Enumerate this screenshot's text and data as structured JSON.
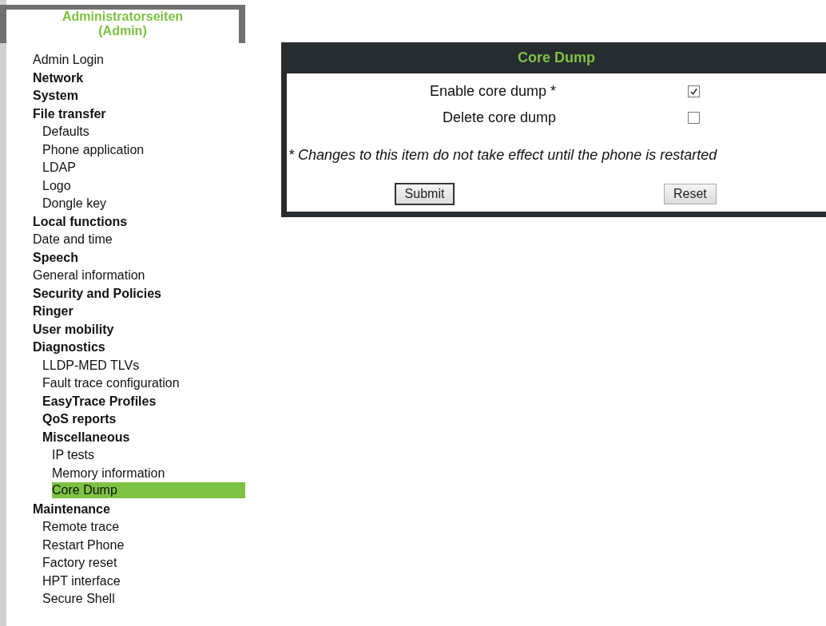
{
  "sidebar": {
    "title": "Administratorseiten (Admin)",
    "items": [
      {
        "label": "Admin Login",
        "kind": "page",
        "selected": false
      },
      {
        "label": "Network",
        "kind": "group",
        "selected": false
      },
      {
        "label": "System",
        "kind": "group",
        "selected": false
      },
      {
        "label": "File transfer",
        "kind": "group",
        "selected": false,
        "children": [
          {
            "label": "Defaults",
            "kind": "page",
            "selected": false
          },
          {
            "label": "Phone application",
            "kind": "page",
            "selected": false
          },
          {
            "label": "LDAP",
            "kind": "page",
            "selected": false
          },
          {
            "label": "Logo",
            "kind": "page",
            "selected": false
          },
          {
            "label": "Dongle key",
            "kind": "page",
            "selected": false
          }
        ]
      },
      {
        "label": "Local functions",
        "kind": "group",
        "selected": false
      },
      {
        "label": "Date and time",
        "kind": "page",
        "selected": false
      },
      {
        "label": "Speech",
        "kind": "group",
        "selected": false
      },
      {
        "label": "General information",
        "kind": "page",
        "selected": false
      },
      {
        "label": "Security and Policies",
        "kind": "group",
        "selected": false
      },
      {
        "label": "Ringer",
        "kind": "group",
        "selected": false
      },
      {
        "label": "User mobility",
        "kind": "group",
        "selected": false
      },
      {
        "label": "Diagnostics",
        "kind": "group",
        "selected": false,
        "children": [
          {
            "label": "LLDP-MED TLVs",
            "kind": "page",
            "selected": false
          },
          {
            "label": "Fault trace configuration",
            "kind": "page",
            "selected": false
          },
          {
            "label": "EasyTrace Profiles",
            "kind": "group",
            "selected": false
          },
          {
            "label": "QoS reports",
            "kind": "group",
            "selected": false
          },
          {
            "label": "Miscellaneous",
            "kind": "group",
            "selected": false,
            "children": [
              {
                "label": "IP tests",
                "kind": "page",
                "selected": false
              },
              {
                "label": "Memory information",
                "kind": "page",
                "selected": false
              },
              {
                "label": "Core Dump",
                "kind": "page",
                "selected": true
              }
            ]
          }
        ]
      },
      {
        "label": "Maintenance",
        "kind": "group",
        "selected": false,
        "children": [
          {
            "label": "Remote trace",
            "kind": "page",
            "selected": false
          },
          {
            "label": "Restart Phone",
            "kind": "page",
            "selected": false
          },
          {
            "label": "Factory reset",
            "kind": "page",
            "selected": false
          },
          {
            "label": "HPT interface",
            "kind": "page",
            "selected": false
          },
          {
            "label": "Secure Shell",
            "kind": "page",
            "selected": false
          }
        ]
      }
    ]
  },
  "panel": {
    "title": "Core Dump",
    "fields": [
      {
        "label": "Enable core dump *",
        "checked": true
      },
      {
        "label": "Delete core dump",
        "checked": false
      }
    ],
    "note": "* Changes to this item do not take effect until the phone is restarted",
    "buttons": [
      "Submit",
      "Reset"
    ]
  }
}
